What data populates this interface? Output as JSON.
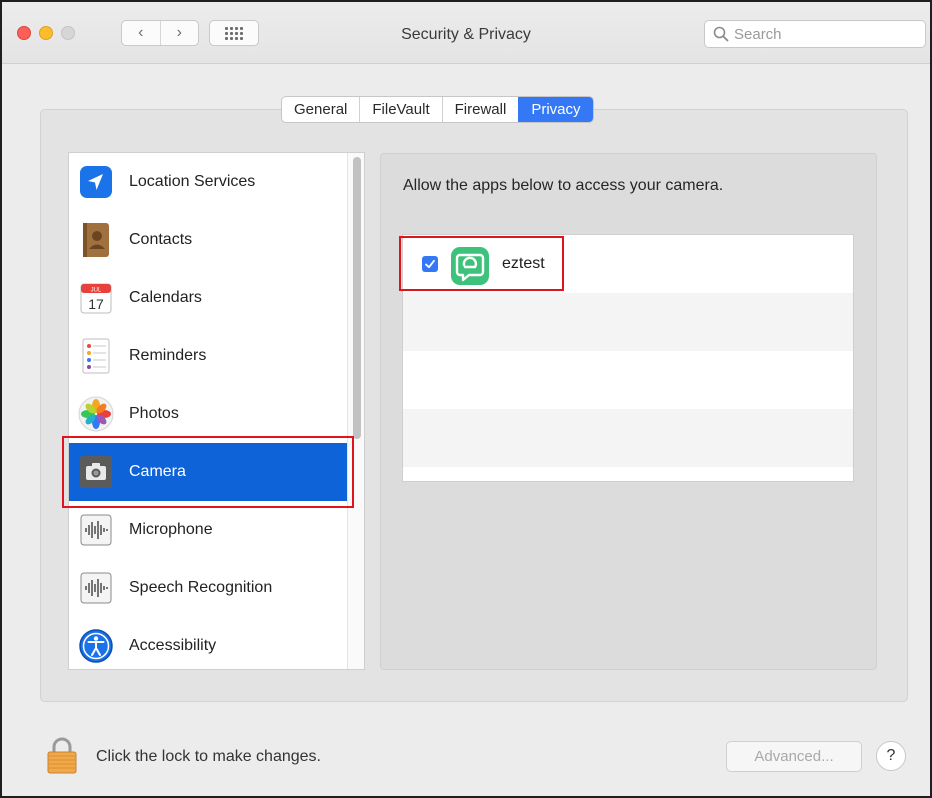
{
  "window": {
    "title": "Security & Privacy",
    "search_placeholder": "Search",
    "nav_back": "‹",
    "nav_forward": "›"
  },
  "tabs": [
    {
      "label": "General",
      "active": false
    },
    {
      "label": "FileVault",
      "active": false
    },
    {
      "label": "Firewall",
      "active": false
    },
    {
      "label": "Privacy",
      "active": true
    }
  ],
  "sidebar": {
    "items": [
      {
        "label": "Location Services",
        "icon": "location-arrow-icon"
      },
      {
        "label": "Contacts",
        "icon": "contacts-book-icon"
      },
      {
        "label": "Calendars",
        "icon": "calendar-icon",
        "calendar_month": "JUL",
        "calendar_day": "17"
      },
      {
        "label": "Reminders",
        "icon": "reminders-list-icon"
      },
      {
        "label": "Photos",
        "icon": "photos-flower-icon"
      },
      {
        "label": "Camera",
        "icon": "camera-icon",
        "selected": true
      },
      {
        "label": "Microphone",
        "icon": "microphone-waveform-icon"
      },
      {
        "label": "Speech Recognition",
        "icon": "speech-waveform-icon"
      },
      {
        "label": "Accessibility",
        "icon": "accessibility-person-icon"
      }
    ]
  },
  "right_pane": {
    "description": "Allow the apps below to access your camera.",
    "apps": [
      {
        "name": "eztest",
        "checked": true,
        "icon": "eztest-app-icon"
      }
    ]
  },
  "footer": {
    "lock_text": "Click the lock to make changes.",
    "advanced_label": "Advanced...",
    "help_label": "?"
  },
  "colors": {
    "accent": "#3478f6",
    "selection": "#0e63d8",
    "highlight_box": "#e0141d"
  }
}
